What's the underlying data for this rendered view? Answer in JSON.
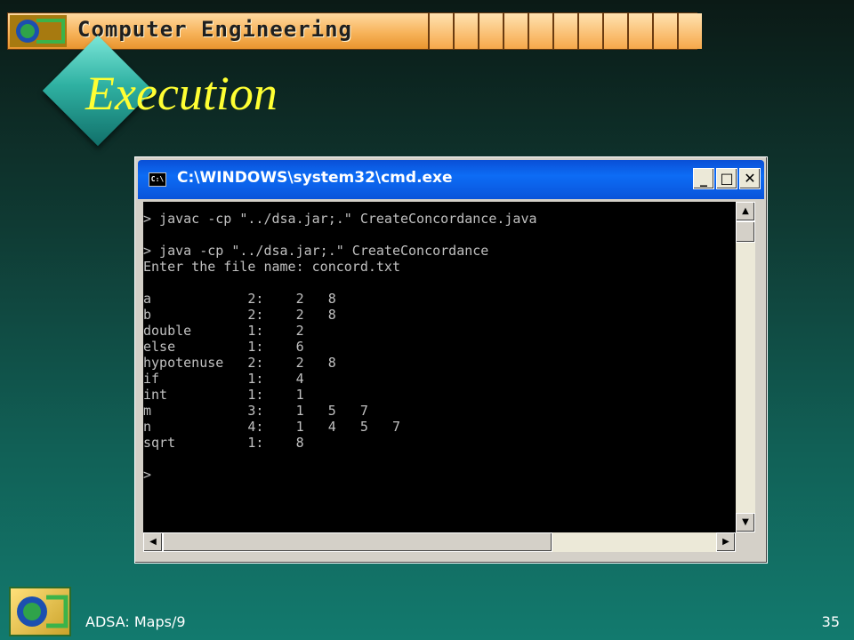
{
  "banner": {
    "title": "Computer Engineering"
  },
  "slide": {
    "title": "Execution"
  },
  "window": {
    "title": "C:\\WINDOWS\\system32\\cmd.exe",
    "buttons": {
      "minimize": "_",
      "maximize": "□",
      "close": "✕"
    },
    "console_lines": [
      "> javac -cp \"../dsa.jar;.\" CreateConcordance.java",
      "",
      "> java -cp \"../dsa.jar;.\" CreateConcordance",
      "Enter the file name: concord.txt",
      "",
      "a            2:    2   8",
      "b            2:    2   8",
      "double       1:    2",
      "else         1:    6",
      "hypotenuse   2:    2   8",
      "if           1:    4",
      "int          1:    1",
      "m            3:    1   5   7",
      "n            4:    1   4   5   7",
      "sqrt         1:    8",
      "",
      ">"
    ],
    "scroll": {
      "up": "▲",
      "down": "▼",
      "left": "◀",
      "right": "▶"
    }
  },
  "footer": {
    "course": "ADSA: Maps/9",
    "page": "35"
  },
  "colors": {
    "title": "#ffff33",
    "console_bg": "#000000",
    "console_text": "#c0c0c0",
    "titlebar": "#0a54da"
  },
  "icons": [
    "logo-icon",
    "cmd-icon",
    "diamond-bullet-icon"
  ]
}
